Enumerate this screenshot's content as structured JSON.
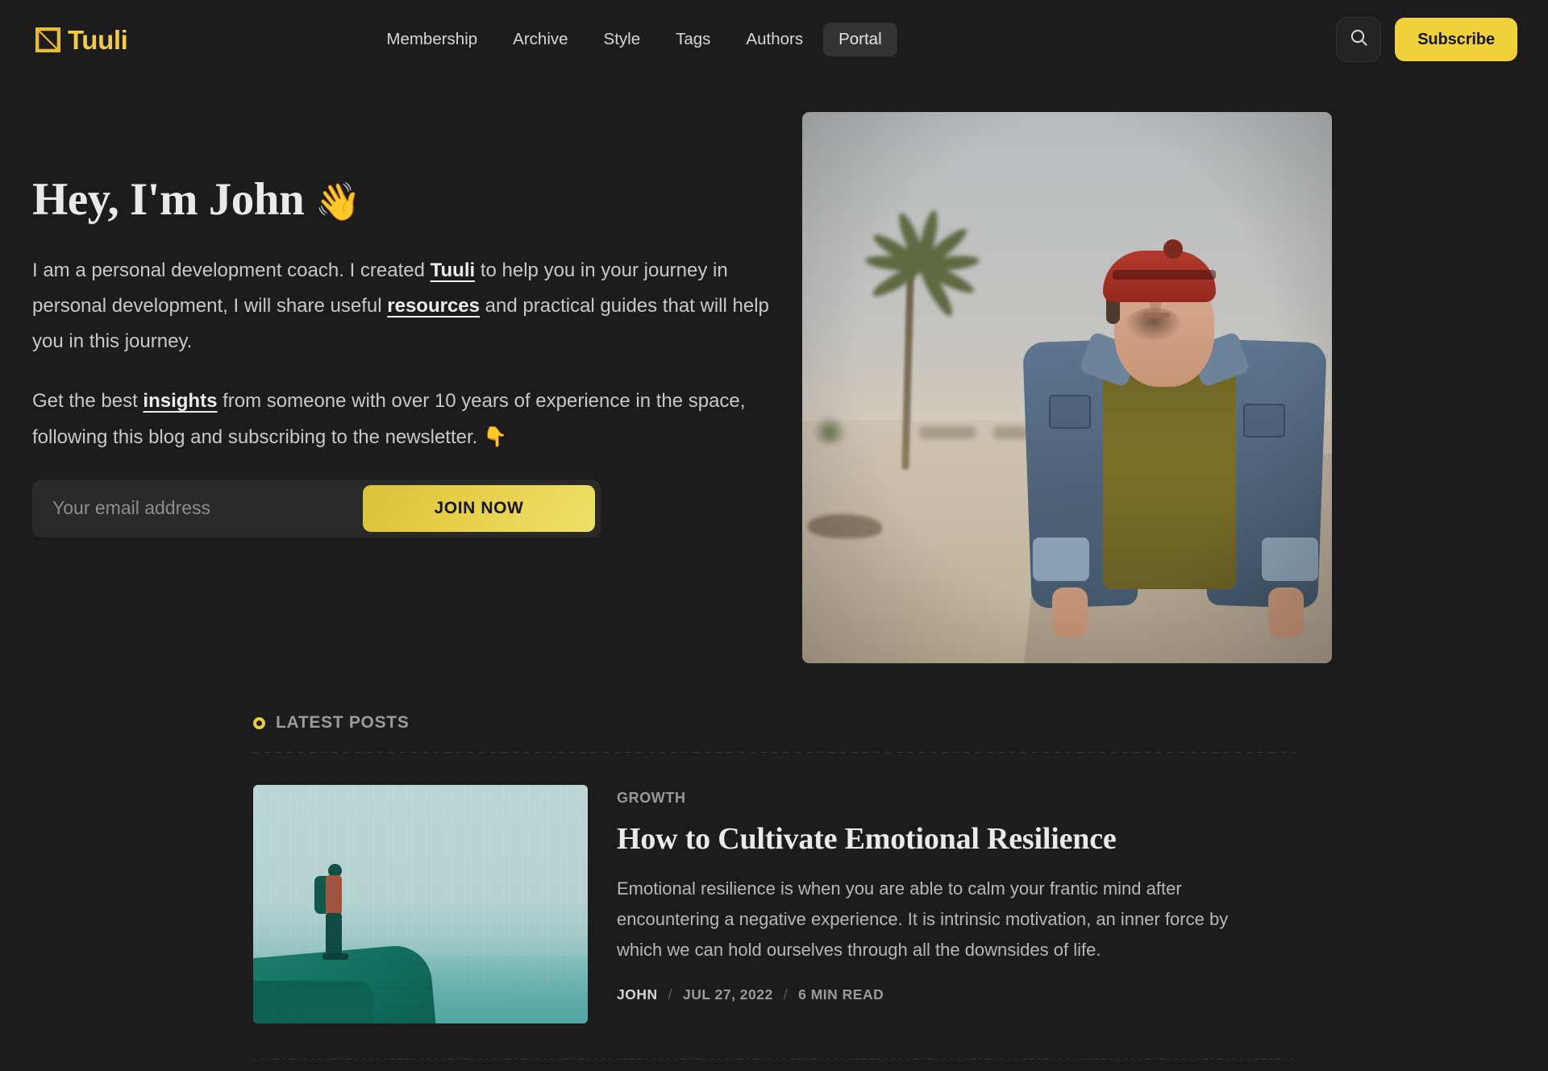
{
  "header": {
    "brand": "Tuuli",
    "brand_icon": "square-diagonal-logo-icon",
    "nav": [
      {
        "label": "Membership",
        "active": false
      },
      {
        "label": "Archive",
        "active": false
      },
      {
        "label": "Style",
        "active": false
      },
      {
        "label": "Tags",
        "active": false
      },
      {
        "label": "Authors",
        "active": false
      },
      {
        "label": "Portal",
        "active": true
      }
    ],
    "search_icon": "search-icon",
    "subscribe_label": "Subscribe",
    "accent_color": "#efd13c"
  },
  "hero": {
    "title": "Hey, I'm John",
    "title_emoji": "👋",
    "paragraph1": {
      "part1": "I am a personal development coach. I created ",
      "link1": "Tuuli",
      "part2": " to help you in your journey in personal development, I will share useful ",
      "link2": "resources",
      "part3": " and practical guides that will help you in this journey."
    },
    "paragraph2": {
      "part1": "Get the best ",
      "link1": "insights",
      "part2": " from someone with over 10 years of experience in the space, following this blog and subscribing to the newsletter. ",
      "emoji": "👇"
    },
    "signup": {
      "email_value": "",
      "email_placeholder": "Your email address",
      "button_label": "JOIN NOW"
    },
    "image_alt": "man-in-red-cap-denim-jacket-on-beach"
  },
  "latest": {
    "section_label": "LATEST POSTS",
    "section_icon": "ring-icon",
    "posts": [
      {
        "tag": "GROWTH",
        "title": "How to Cultivate Emotional Resilience",
        "excerpt": "Emotional resilience is when you are able to calm your frantic mind after encountering a negative experience. It is intrinsic motivation, an inner force by which we can hold ourselves through all the downsides of life.",
        "author": "JOHN",
        "date": "JUL 27, 2022",
        "read_time": "6 MIN READ",
        "separator": "/",
        "thumb_alt": "hiker-standing-on-cliff-teal-tone"
      }
    ]
  }
}
